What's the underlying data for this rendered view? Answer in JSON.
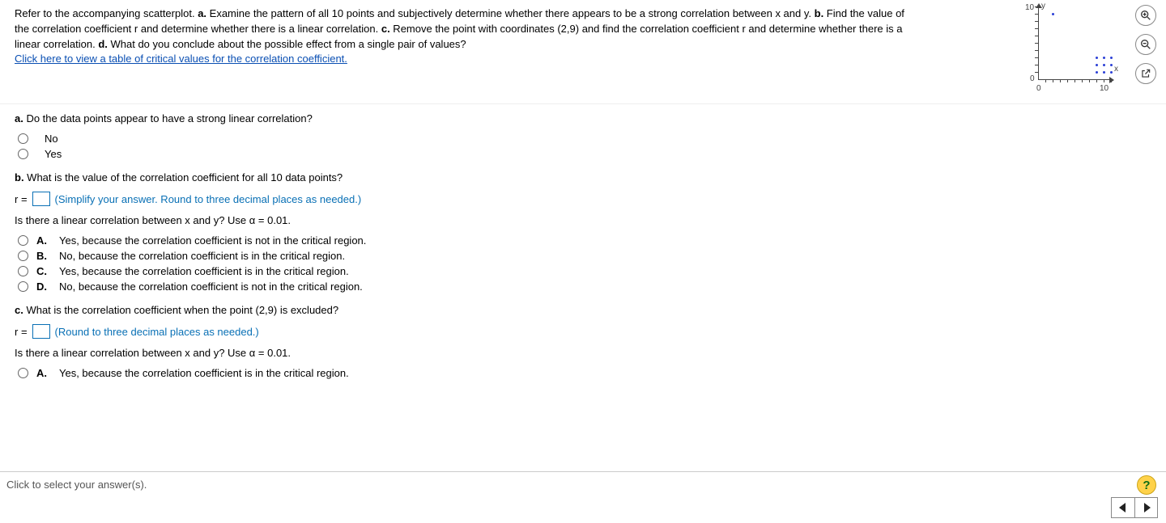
{
  "prompt": {
    "intro": "Refer to the accompanying scatterplot. ",
    "a_label": "a.",
    "a_text": " Examine the pattern of all 10 points and subjectively determine whether there appears to be a strong correlation between x and y. ",
    "b_label": "b.",
    "b_text": " Find the value of the correlation coefficient r and determine whether there is a linear correlation. ",
    "c_label": "c.",
    "c_text": " Remove the point with coordinates (2,9) and find the correlation coefficient r and determine whether there is a linear correlation. ",
    "d_label": "d.",
    "d_text": " What do you conclude about the possible effect from a single pair of values?",
    "link": "Click here to view a table of critical values for the correlation coefficient."
  },
  "plot": {
    "y_label": "y",
    "x_label": "x",
    "y_max": "10",
    "y_min": "0",
    "x_min": "0",
    "x_max": "10"
  },
  "chart_data": {
    "type": "scatter",
    "title": "",
    "xlabel": "x",
    "ylabel": "y",
    "xlim": [
      0,
      10
    ],
    "ylim": [
      0,
      10
    ],
    "points": [
      {
        "x": 2,
        "y": 9
      },
      {
        "x": 8,
        "y": 1
      },
      {
        "x": 8,
        "y": 2
      },
      {
        "x": 8,
        "y": 3
      },
      {
        "x": 9,
        "y": 1
      },
      {
        "x": 9,
        "y": 2
      },
      {
        "x": 9,
        "y": 3
      },
      {
        "x": 10,
        "y": 1
      },
      {
        "x": 10,
        "y": 2
      },
      {
        "x": 10,
        "y": 3
      }
    ]
  },
  "qa": {
    "heading_label": "a.",
    "heading_text": " Do the data points appear to have a strong linear correlation?",
    "options": [
      "No",
      "Yes"
    ]
  },
  "qb": {
    "heading_label": "b.",
    "heading_text": " What is the value of the correlation coefficient for all 10 data points?",
    "r_prefix": "r =",
    "r_value": "",
    "hint": "(Simplify your answer. Round to three decimal places as needed.)",
    "subtext": "Is there a linear correlation between x and y? Use α = 0.01.",
    "options": [
      {
        "letter": "A.",
        "text": "Yes, because the correlation coefficient is not in the critical region."
      },
      {
        "letter": "B.",
        "text": "No, because the correlation coefficient is in the critical region."
      },
      {
        "letter": "C.",
        "text": "Yes, because the correlation coefficient is in the critical region."
      },
      {
        "letter": "D.",
        "text": "No, because the correlation coefficient is not in the critical region."
      }
    ]
  },
  "qc": {
    "heading_label": "c.",
    "heading_text": " What is the correlation coefficient when the point (2,9) is excluded?",
    "r_prefix": "r =",
    "r_value": "",
    "hint": "(Round to three decimal places as needed.)",
    "subtext": "Is there a linear correlation between x and y? Use α = 0.01.",
    "options": [
      {
        "letter": "A.",
        "text": "Yes, because the correlation coefficient is in the critical region."
      }
    ]
  },
  "footer": {
    "text": "Click to select your answer(s).",
    "help": "?"
  }
}
